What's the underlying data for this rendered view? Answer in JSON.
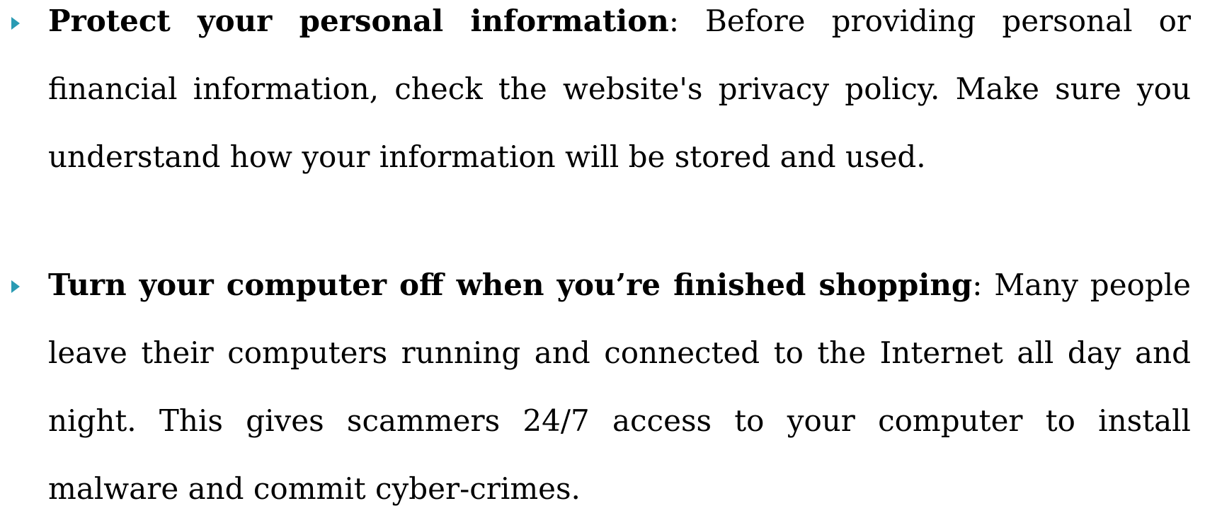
{
  "colors": {
    "bullet": "#2a9bb3",
    "text": "#000000",
    "background": "#ffffff"
  },
  "items": [
    {
      "term": "Protect your personal information",
      "body": ": Before providing personal or financial information, check the website's privacy policy. Make sure you understand how your information will be stored and used."
    },
    {
      "term": "Turn your computer off when you’re finished shopping",
      "body": ": Many people leave their computers running and connected to the Internet all day and night. This gives scammers 24/7 access to your computer to install malware and commit cyber-crimes."
    }
  ]
}
